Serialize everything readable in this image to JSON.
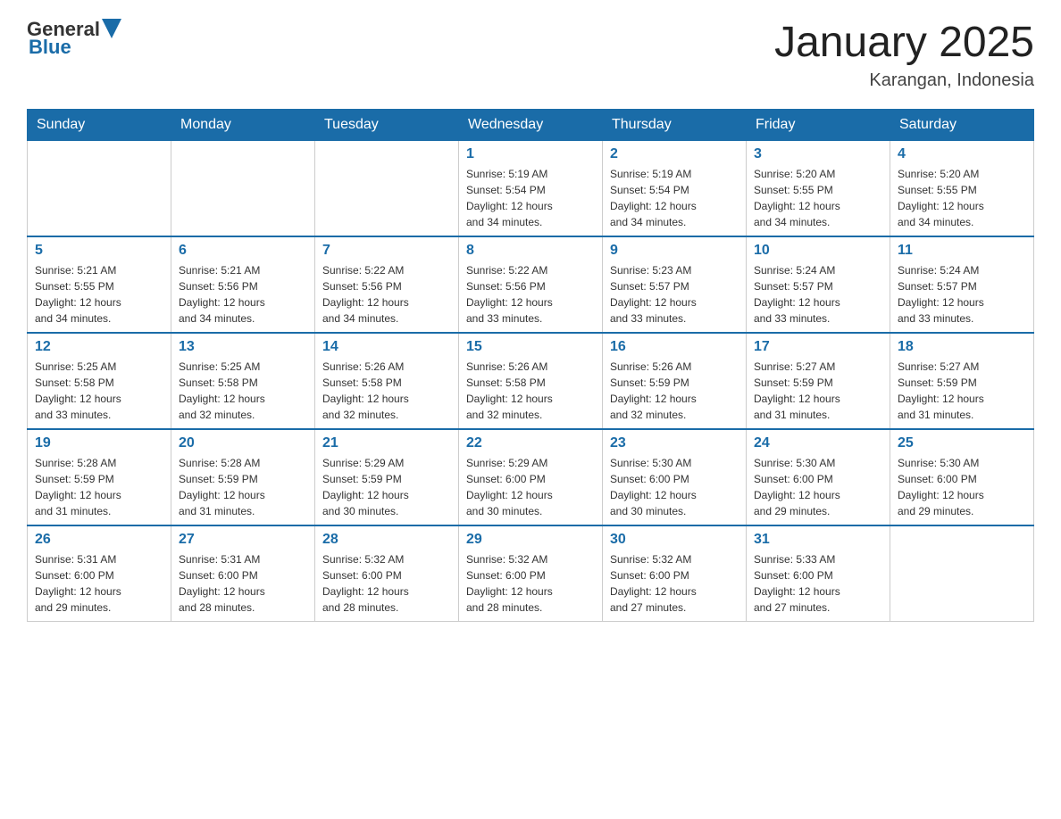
{
  "header": {
    "logo_general": "General",
    "logo_blue": "Blue",
    "title": "January 2025",
    "location": "Karangan, Indonesia"
  },
  "calendar": {
    "days_of_week": [
      "Sunday",
      "Monday",
      "Tuesday",
      "Wednesday",
      "Thursday",
      "Friday",
      "Saturday"
    ],
    "weeks": [
      [
        {
          "day": "",
          "info": ""
        },
        {
          "day": "",
          "info": ""
        },
        {
          "day": "",
          "info": ""
        },
        {
          "day": "1",
          "info": "Sunrise: 5:19 AM\nSunset: 5:54 PM\nDaylight: 12 hours\nand 34 minutes."
        },
        {
          "day": "2",
          "info": "Sunrise: 5:19 AM\nSunset: 5:54 PM\nDaylight: 12 hours\nand 34 minutes."
        },
        {
          "day": "3",
          "info": "Sunrise: 5:20 AM\nSunset: 5:55 PM\nDaylight: 12 hours\nand 34 minutes."
        },
        {
          "day": "4",
          "info": "Sunrise: 5:20 AM\nSunset: 5:55 PM\nDaylight: 12 hours\nand 34 minutes."
        }
      ],
      [
        {
          "day": "5",
          "info": "Sunrise: 5:21 AM\nSunset: 5:55 PM\nDaylight: 12 hours\nand 34 minutes."
        },
        {
          "day": "6",
          "info": "Sunrise: 5:21 AM\nSunset: 5:56 PM\nDaylight: 12 hours\nand 34 minutes."
        },
        {
          "day": "7",
          "info": "Sunrise: 5:22 AM\nSunset: 5:56 PM\nDaylight: 12 hours\nand 34 minutes."
        },
        {
          "day": "8",
          "info": "Sunrise: 5:22 AM\nSunset: 5:56 PM\nDaylight: 12 hours\nand 33 minutes."
        },
        {
          "day": "9",
          "info": "Sunrise: 5:23 AM\nSunset: 5:57 PM\nDaylight: 12 hours\nand 33 minutes."
        },
        {
          "day": "10",
          "info": "Sunrise: 5:24 AM\nSunset: 5:57 PM\nDaylight: 12 hours\nand 33 minutes."
        },
        {
          "day": "11",
          "info": "Sunrise: 5:24 AM\nSunset: 5:57 PM\nDaylight: 12 hours\nand 33 minutes."
        }
      ],
      [
        {
          "day": "12",
          "info": "Sunrise: 5:25 AM\nSunset: 5:58 PM\nDaylight: 12 hours\nand 33 minutes."
        },
        {
          "day": "13",
          "info": "Sunrise: 5:25 AM\nSunset: 5:58 PM\nDaylight: 12 hours\nand 32 minutes."
        },
        {
          "day": "14",
          "info": "Sunrise: 5:26 AM\nSunset: 5:58 PM\nDaylight: 12 hours\nand 32 minutes."
        },
        {
          "day": "15",
          "info": "Sunrise: 5:26 AM\nSunset: 5:58 PM\nDaylight: 12 hours\nand 32 minutes."
        },
        {
          "day": "16",
          "info": "Sunrise: 5:26 AM\nSunset: 5:59 PM\nDaylight: 12 hours\nand 32 minutes."
        },
        {
          "day": "17",
          "info": "Sunrise: 5:27 AM\nSunset: 5:59 PM\nDaylight: 12 hours\nand 31 minutes."
        },
        {
          "day": "18",
          "info": "Sunrise: 5:27 AM\nSunset: 5:59 PM\nDaylight: 12 hours\nand 31 minutes."
        }
      ],
      [
        {
          "day": "19",
          "info": "Sunrise: 5:28 AM\nSunset: 5:59 PM\nDaylight: 12 hours\nand 31 minutes."
        },
        {
          "day": "20",
          "info": "Sunrise: 5:28 AM\nSunset: 5:59 PM\nDaylight: 12 hours\nand 31 minutes."
        },
        {
          "day": "21",
          "info": "Sunrise: 5:29 AM\nSunset: 5:59 PM\nDaylight: 12 hours\nand 30 minutes."
        },
        {
          "day": "22",
          "info": "Sunrise: 5:29 AM\nSunset: 6:00 PM\nDaylight: 12 hours\nand 30 minutes."
        },
        {
          "day": "23",
          "info": "Sunrise: 5:30 AM\nSunset: 6:00 PM\nDaylight: 12 hours\nand 30 minutes."
        },
        {
          "day": "24",
          "info": "Sunrise: 5:30 AM\nSunset: 6:00 PM\nDaylight: 12 hours\nand 29 minutes."
        },
        {
          "day": "25",
          "info": "Sunrise: 5:30 AM\nSunset: 6:00 PM\nDaylight: 12 hours\nand 29 minutes."
        }
      ],
      [
        {
          "day": "26",
          "info": "Sunrise: 5:31 AM\nSunset: 6:00 PM\nDaylight: 12 hours\nand 29 minutes."
        },
        {
          "day": "27",
          "info": "Sunrise: 5:31 AM\nSunset: 6:00 PM\nDaylight: 12 hours\nand 28 minutes."
        },
        {
          "day": "28",
          "info": "Sunrise: 5:32 AM\nSunset: 6:00 PM\nDaylight: 12 hours\nand 28 minutes."
        },
        {
          "day": "29",
          "info": "Sunrise: 5:32 AM\nSunset: 6:00 PM\nDaylight: 12 hours\nand 28 minutes."
        },
        {
          "day": "30",
          "info": "Sunrise: 5:32 AM\nSunset: 6:00 PM\nDaylight: 12 hours\nand 27 minutes."
        },
        {
          "day": "31",
          "info": "Sunrise: 5:33 AM\nSunset: 6:00 PM\nDaylight: 12 hours\nand 27 minutes."
        },
        {
          "day": "",
          "info": ""
        }
      ]
    ]
  }
}
